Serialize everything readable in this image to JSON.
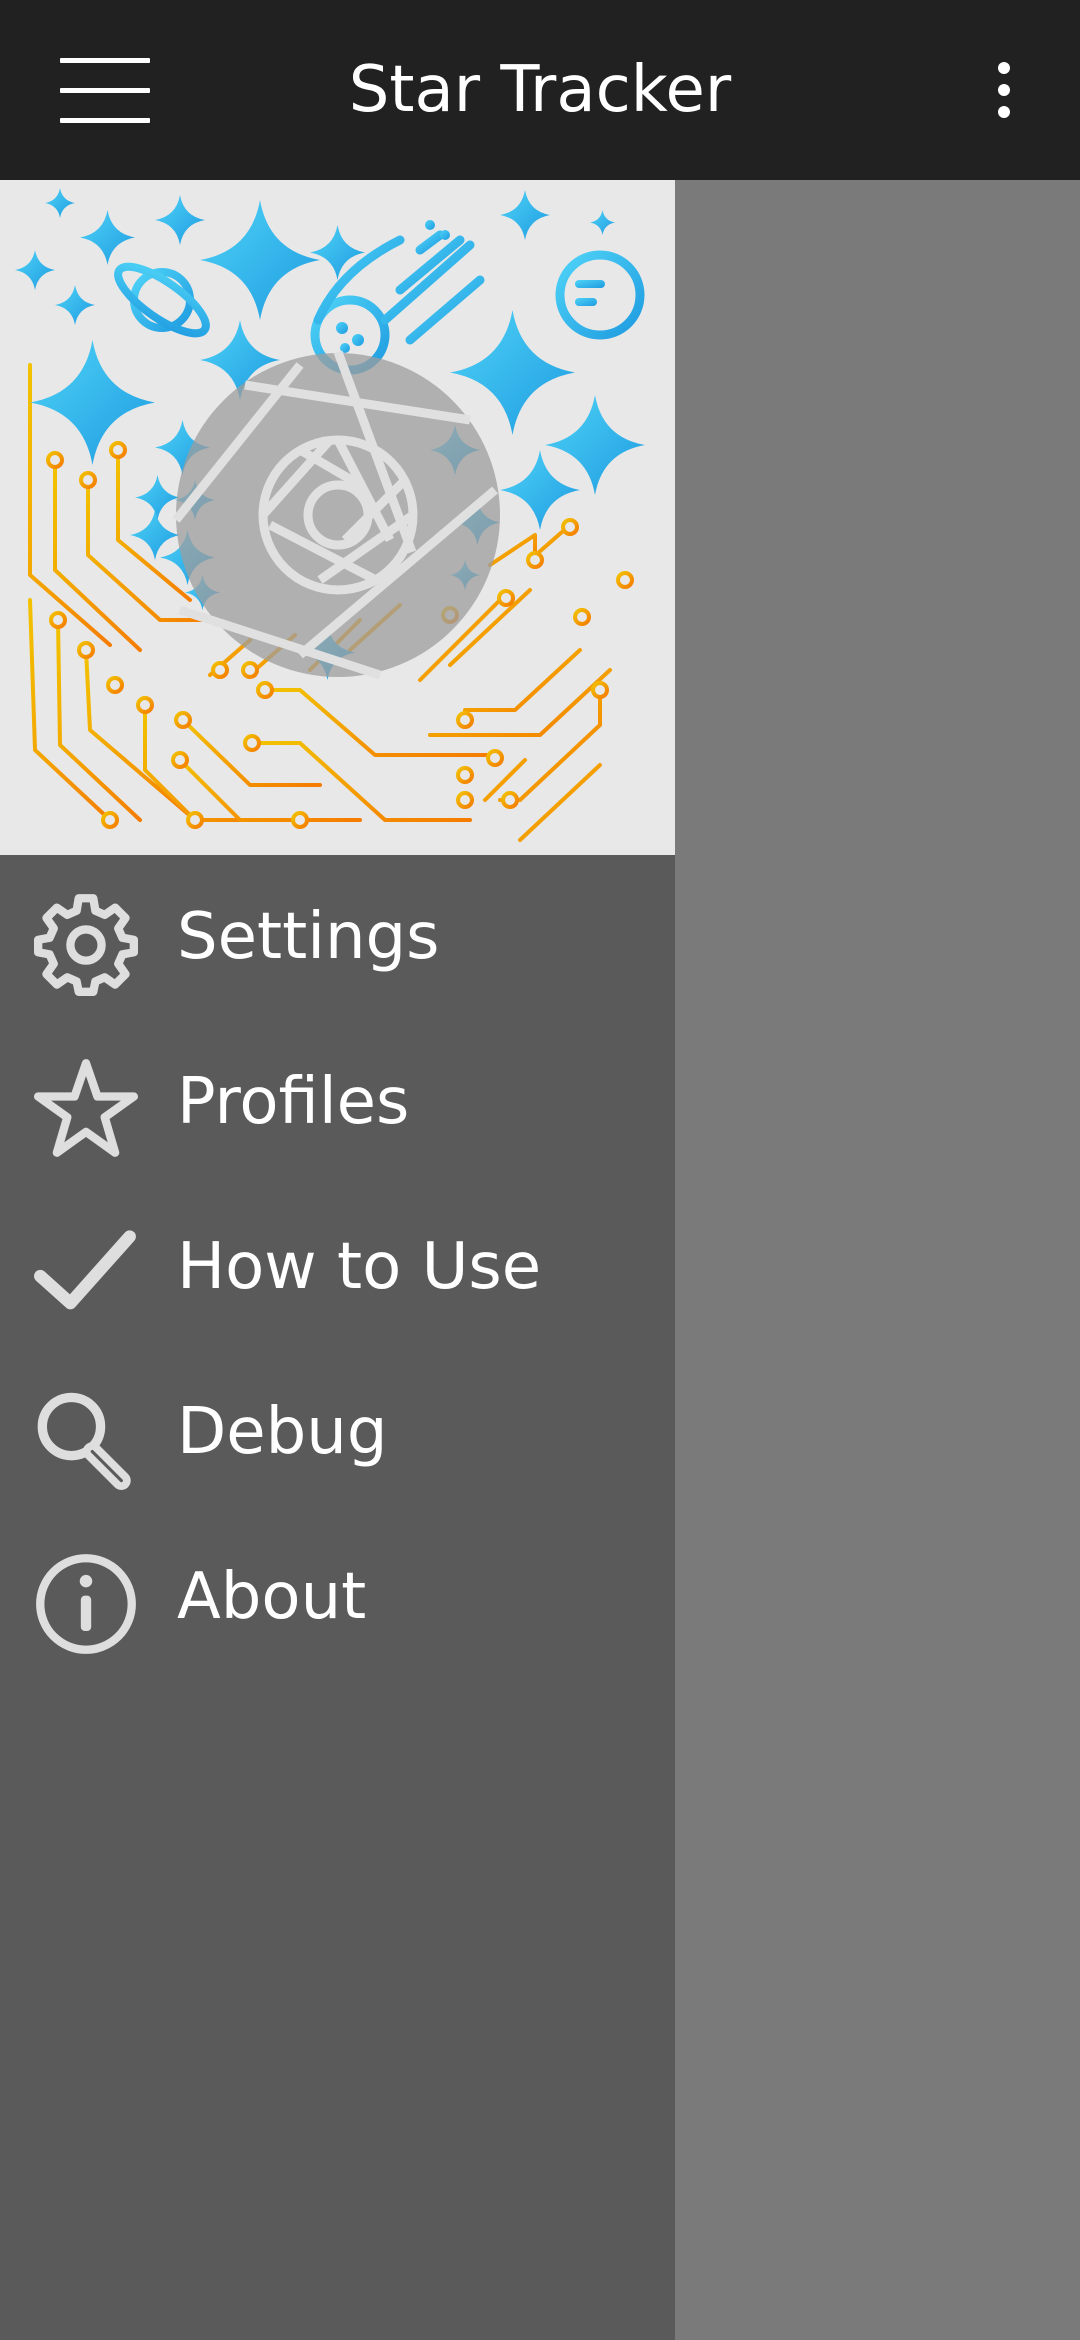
{
  "app_bar": {
    "title": "Star Tracker",
    "menu_icon": "hamburger-menu-icon",
    "overflow_icon": "more-vertical-icon"
  },
  "drawer": {
    "header_image": "space-circuit-illustration",
    "items": [
      {
        "label": "Settings",
        "icon": "gear-icon"
      },
      {
        "label": "Profiles",
        "icon": "star-icon"
      },
      {
        "label": "How to Use",
        "icon": "checkmark-icon"
      },
      {
        "label": "Debug",
        "icon": "magnifier-icon"
      },
      {
        "label": "About",
        "icon": "info-icon"
      }
    ]
  },
  "colors": {
    "app_bar": "#212121",
    "drawer_background": "#5a5a5a",
    "header_background": "#e8e8e8",
    "scrim": "#7a7a7a",
    "icon_tint": "#dedede",
    "star_blue": "#29b6f6",
    "circuit_orange": "#f57c00",
    "circuit_yellow": "#f2c200"
  }
}
